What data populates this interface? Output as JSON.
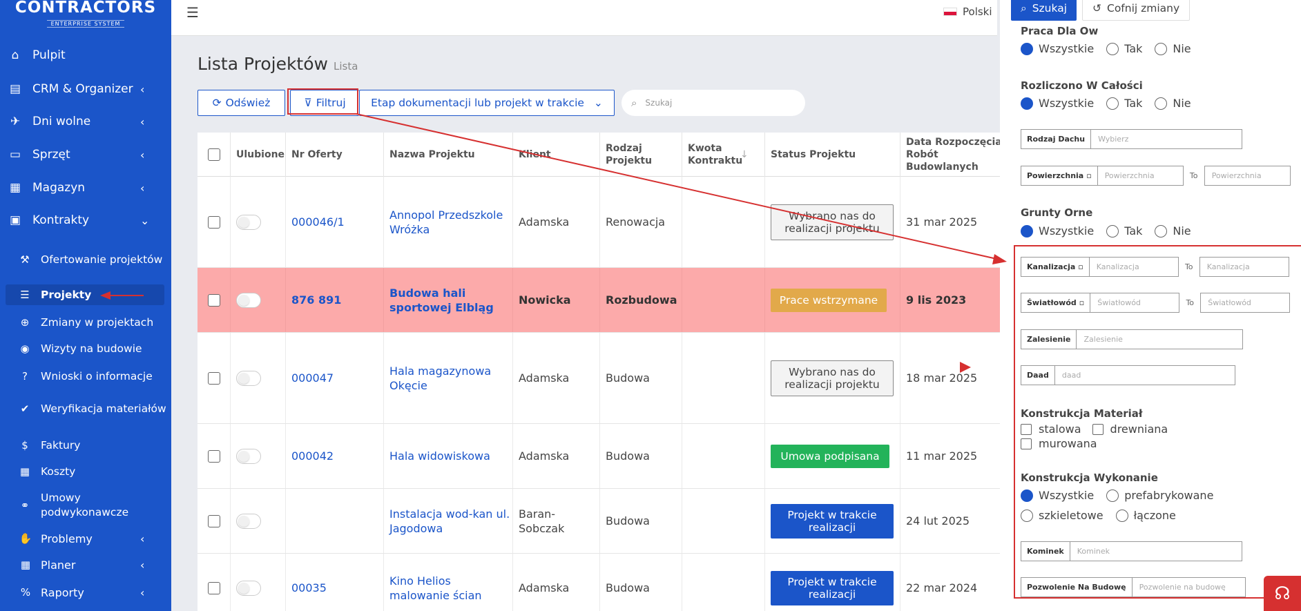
{
  "app": {
    "logo_main": "CONTRACTORS",
    "logo_sub": "ENTERPRISE SYSTEM"
  },
  "sidebar": {
    "items": [
      {
        "label": "Pulpit",
        "icon": "home-icon",
        "glyph": "⌂",
        "chevron": ""
      },
      {
        "label": "CRM & Organizer",
        "icon": "address-card-icon",
        "glyph": "▤",
        "chevron": "‹"
      },
      {
        "label": "Dni wolne",
        "icon": "plane-icon",
        "glyph": "✈",
        "chevron": "‹"
      },
      {
        "label": "Sprzęt",
        "icon": "hdd-icon",
        "glyph": "▭",
        "chevron": "‹"
      },
      {
        "label": "Magazyn",
        "icon": "boxes-icon",
        "glyph": "▦",
        "chevron": "‹"
      },
      {
        "label": "Kontrakty",
        "icon": "briefcase-icon",
        "glyph": "▣",
        "chevron": "⌄"
      }
    ],
    "sub_items": [
      {
        "label": "Ofertowanie projektów",
        "icon": "gavel-icon",
        "glyph": "⚒"
      },
      {
        "label": "Projekty",
        "icon": "list-icon",
        "glyph": "☰"
      },
      {
        "label": "Zmiany w projektach",
        "icon": "plus-circle-icon",
        "glyph": "⊕"
      },
      {
        "label": "Wizyty na budowie",
        "icon": "eye-icon",
        "glyph": "◉"
      },
      {
        "label": "Wnioski o informacje",
        "icon": "question-circle-icon",
        "glyph": "?"
      },
      {
        "label": "Weryfikacja materiałów",
        "icon": "check-icon",
        "glyph": "✔"
      },
      {
        "label": "Faktury",
        "icon": "dollar-icon",
        "glyph": "$"
      },
      {
        "label": "Koszty",
        "icon": "calculator-icon",
        "glyph": "▦"
      },
      {
        "label": "Umowy podwykonawcze",
        "icon": "handshake-icon",
        "glyph": "⚭"
      }
    ],
    "bottom_items": [
      {
        "label": "Problemy",
        "icon": "hand-icon",
        "glyph": "✋",
        "chevron": "‹"
      },
      {
        "label": "Planer",
        "icon": "calendar-icon",
        "glyph": "▦",
        "chevron": "‹"
      },
      {
        "label": "Raporty",
        "icon": "percent-icon",
        "glyph": "%",
        "chevron": "‹"
      }
    ]
  },
  "topbar": {
    "language": "Polski"
  },
  "page": {
    "title": "Lista Projektów",
    "subtitle": "Lista"
  },
  "toolbar": {
    "refresh_label": "Odśwież",
    "filter_label": "Filtruj",
    "stage_label": "Etap dokumentacji lub projekt w trakcie",
    "search_placeholder": "Szukaj"
  },
  "table": {
    "headers": [
      "Ulubione",
      "Nr Oferty",
      "Nazwa Projektu",
      "Klient",
      "Rodzaj Projektu",
      "Kwota Kontraktu",
      "Status Projektu",
      "Data Rozpoczęcia Robót Budowlanych"
    ],
    "rows": [
      {
        "offer": "000046/1",
        "name": "Annopol Przedszkole Wróżka",
        "client": "Adamska",
        "type": "Renowacja",
        "amount": "",
        "status": "Wybrano nas do realizacji projektu",
        "status_style": "gray",
        "date": "31 mar 2025"
      },
      {
        "offer": "876 891",
        "name": "Budowa hali sportowej Elbląg",
        "client": "Nowicka",
        "type": "Rozbudowa",
        "amount": "",
        "status": "Prace wstrzymane",
        "status_style": "orange",
        "date": "9 lis 2023"
      },
      {
        "offer": "000047",
        "name": "Hala magazynowa Okęcie",
        "client": "Adamska",
        "type": "Budowa",
        "amount": "",
        "status": "Wybrano nas do realizacji projektu",
        "status_style": "gray",
        "date": "18 mar 2025"
      },
      {
        "offer": "000042",
        "name": "Hala widowiskowa",
        "client": "Adamska",
        "type": "Budowa",
        "amount": "",
        "status": "Umowa podpisana",
        "status_style": "green",
        "date": "11 mar 2025"
      },
      {
        "offer": "",
        "name": "Instalacja wod-kan ul. Jagodowa",
        "client": "Baran-Sobczak",
        "type": "Budowa",
        "amount": "",
        "status": "Projekt w trakcie realizacji",
        "status_style": "blue",
        "date": "24 lut 2025"
      },
      {
        "offer": "00035",
        "name": "Kino Helios malowanie ścian",
        "client": "Adamska",
        "type": "Budowa",
        "amount": "",
        "status": "Projekt w trakcie realizacji",
        "status_style": "blue",
        "date": "22 mar 2024"
      }
    ]
  },
  "filters": {
    "search_button": "Szukaj",
    "reset_button": "Cofnij zmiany",
    "praca_title": "Praca Dla Ow",
    "rozliczono_title": "Rozliczono W Całości",
    "grunty_title": "Grunty Orne",
    "konstrukcja_material_title": "Konstrukcja Materiał",
    "konstrukcja_wykonanie_title": "Konstrukcja Wykonanie",
    "opt_all": "Wszystkie",
    "opt_yes": "Tak",
    "opt_no": "Nie",
    "rodzaj_dachu_label": "Rodzaj Dachu",
    "rodzaj_dachu_placeholder": "Wybierz",
    "powierzchnia_label": "Powierzchnia",
    "powierzchnia_placeholder": "Powierzchnia",
    "to_label": "To",
    "kanalizacja_label": "Kanalizacja",
    "kanalizacja_placeholder": "Kanalizacja",
    "swiatlowod_label": "Światłowód",
    "swiatlowod_placeholder": "Światłowód",
    "zalesienie_label": "Zalesienie",
    "zalesienie_placeholder": "Zalesienie",
    "daad_label": "Daad",
    "daad_placeholder": "daad",
    "material_opts": [
      "stalowa",
      "drewniana",
      "murowana"
    ],
    "wykonanie_opts": [
      "Wszystkie",
      "prefabrykowane",
      "szkieletowe",
      "łączone"
    ],
    "kominek_label": "Kominek",
    "kominek_placeholder": "Kominek",
    "pozwolenie_label": "Pozwolenie Na Budowę",
    "pozwolenie_placeholder": "Pozwolenie na budowę"
  },
  "colors": {
    "primary": "#1b55c9",
    "sidebar": "#1b55c9",
    "highlight_row": "#fcaaaa",
    "annotation": "#d63030",
    "orange_status": "#e2a94a",
    "green_status": "#23b35a"
  }
}
